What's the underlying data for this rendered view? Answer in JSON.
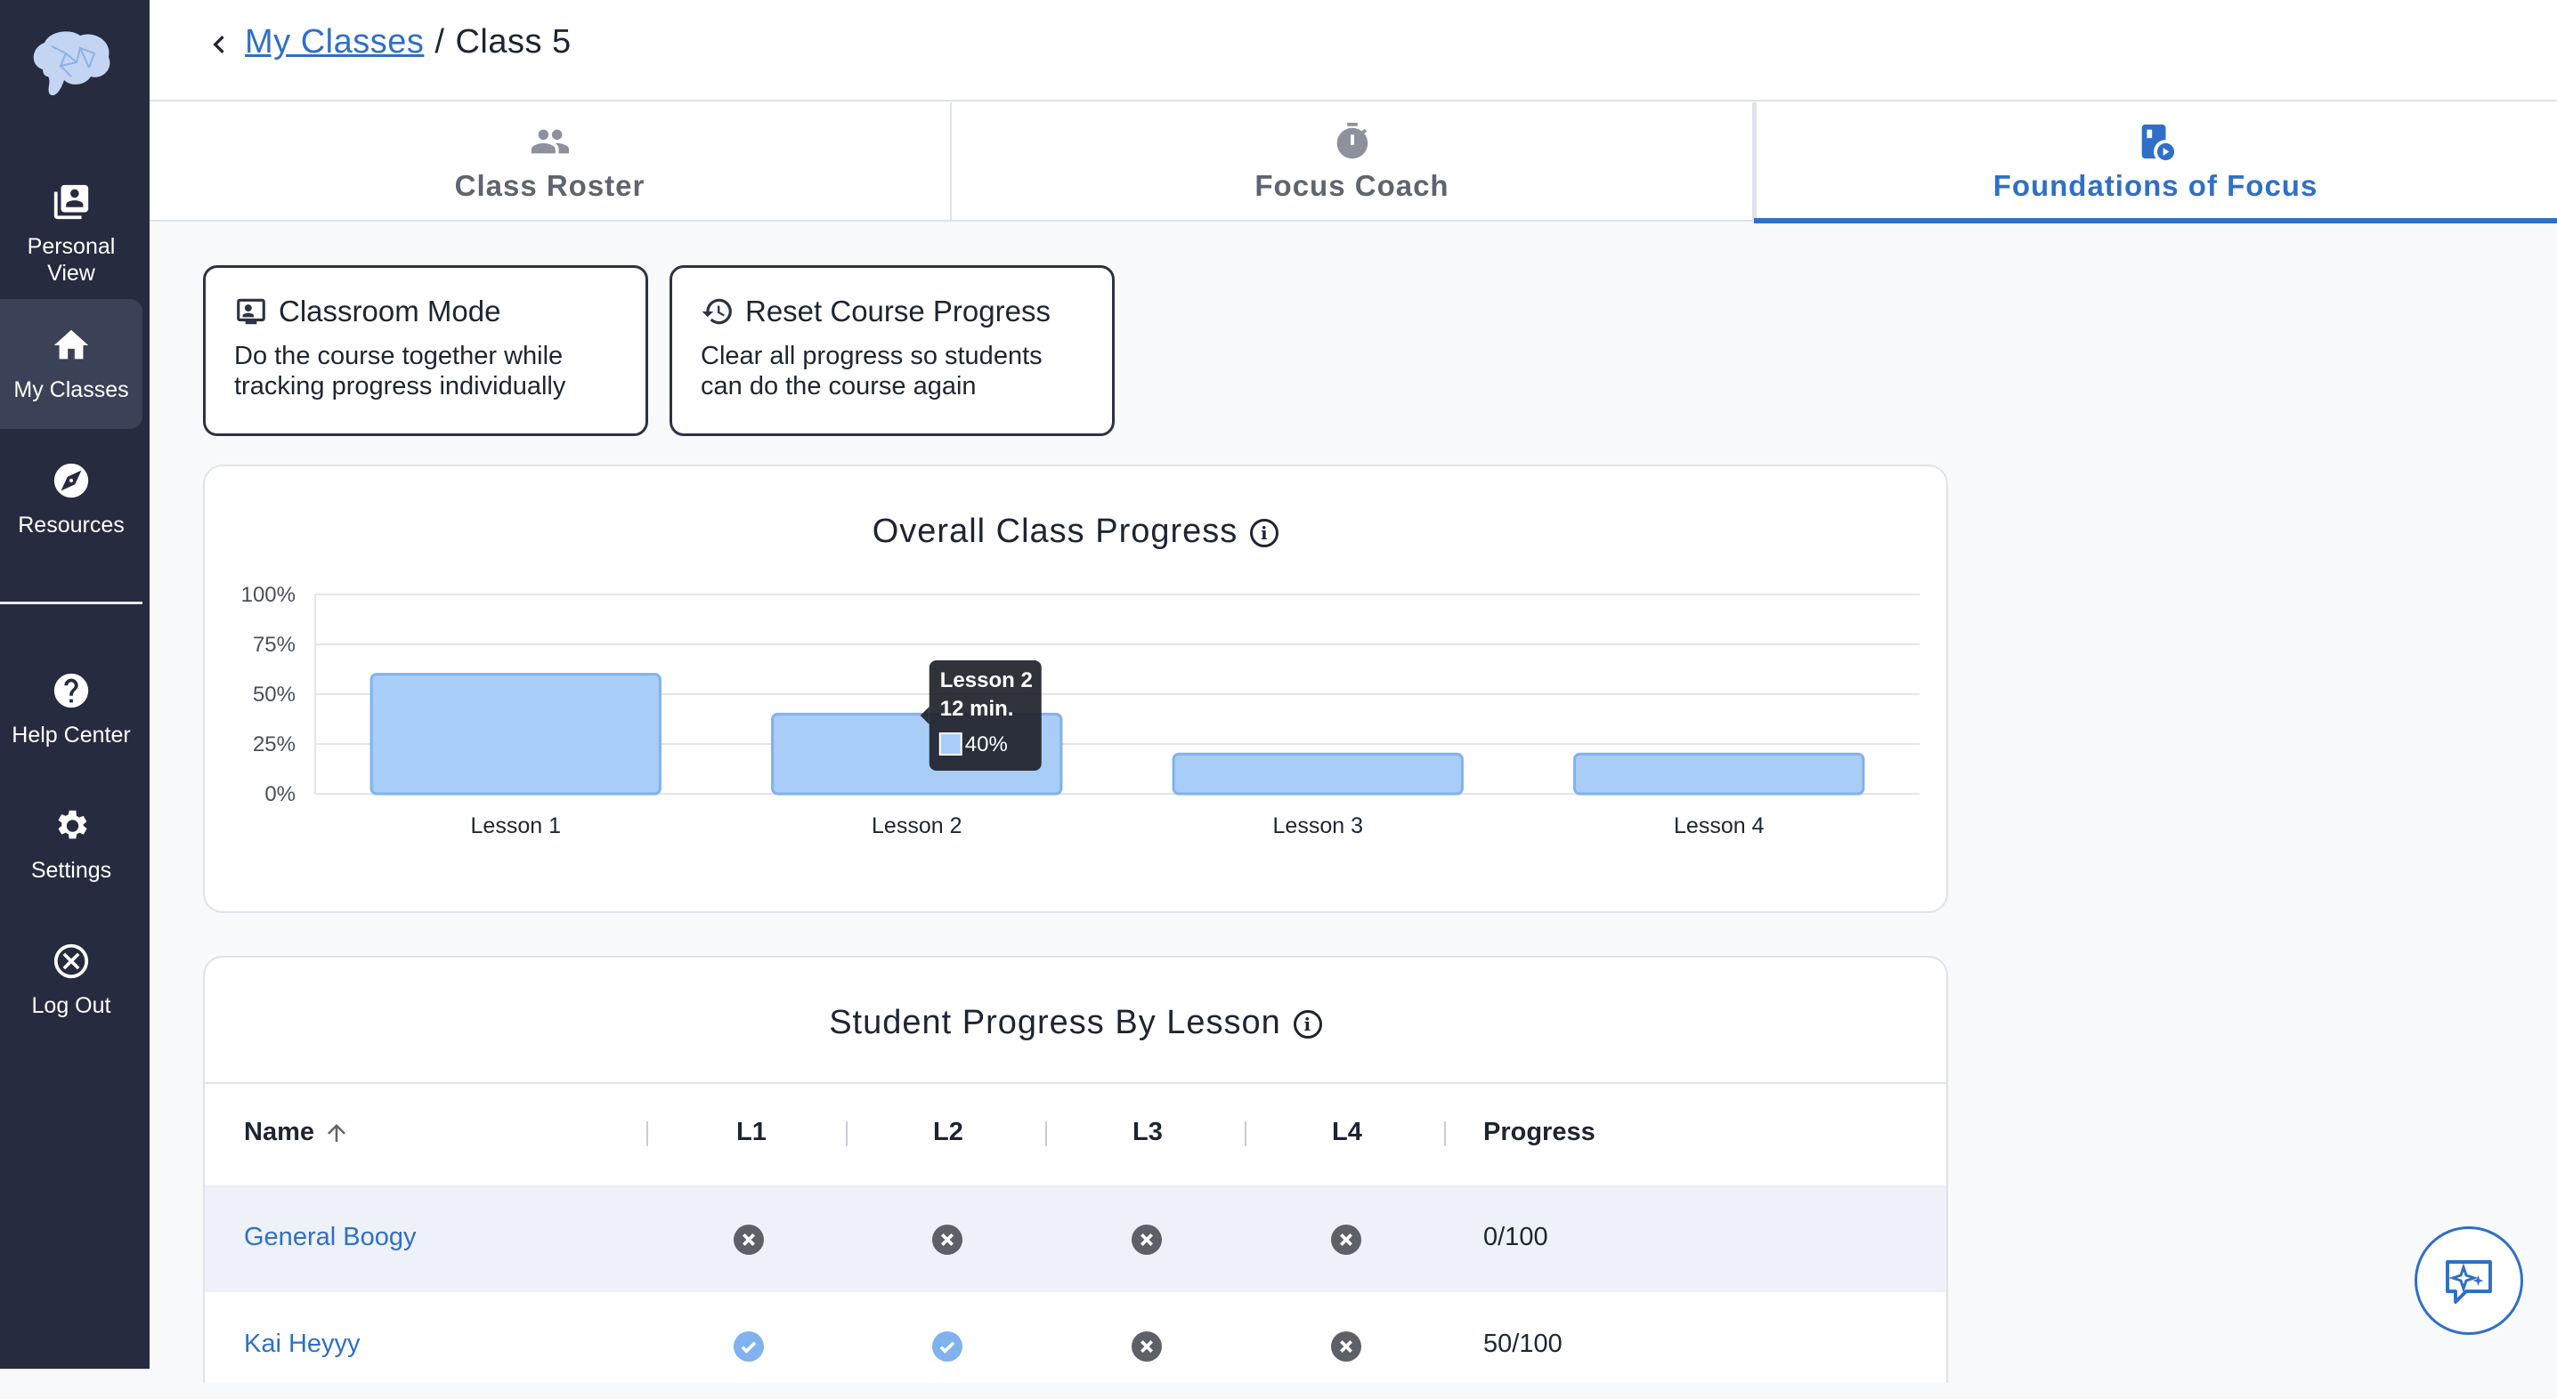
{
  "sidebar": {
    "items": [
      {
        "label": "Personal\nView",
        "icon": "personal-view-icon"
      },
      {
        "label": "My Classes",
        "icon": "home-icon"
      },
      {
        "label": "Resources",
        "icon": "compass-icon"
      },
      {
        "label": "Help Center",
        "icon": "help-icon"
      },
      {
        "label": "Settings",
        "icon": "gear-icon"
      },
      {
        "label": "Log Out",
        "icon": "close-circle-icon"
      }
    ]
  },
  "breadcrumb": {
    "parent": "My Classes",
    "separator": "/",
    "current": "Class 5"
  },
  "tabs": [
    {
      "label": "Class Roster",
      "icon": "people-icon"
    },
    {
      "label": "Focus Coach",
      "icon": "stopwatch-icon"
    },
    {
      "label": "Foundations of Focus",
      "icon": "course-play-icon",
      "active": true
    }
  ],
  "actions": {
    "classroom": {
      "title": "Classroom Mode",
      "desc_line1": "Do the course together while",
      "desc_line2": "tracking progress individually"
    },
    "reset": {
      "title": "Reset Course Progress",
      "desc_line1": "Clear all progress so students",
      "desc_line2": "can do the course again"
    }
  },
  "chart_data": {
    "type": "bar",
    "title": "Overall Class Progress",
    "categories": [
      "Lesson 1",
      "Lesson 2",
      "Lesson 3",
      "Lesson 4"
    ],
    "values": [
      60,
      40,
      20,
      20
    ],
    "y_ticks": [
      "0%",
      "25%",
      "50%",
      "75%",
      "100%"
    ],
    "ylim": [
      0,
      100
    ],
    "grid": true,
    "bar_color": "#a8cdf7",
    "bar_border": "#7fb2ee",
    "tooltip": {
      "title": "Lesson 2",
      "duration": "12 min.",
      "value": "40%"
    }
  },
  "table": {
    "title": "Student Progress By Lesson",
    "headers": {
      "name": "Name",
      "l1": "L1",
      "l2": "L2",
      "l3": "L3",
      "l4": "L4",
      "progress": "Progress"
    },
    "rows": [
      {
        "name": "General Boogy",
        "lessons": [
          "x",
          "x",
          "x",
          "x"
        ],
        "progress": "0/100"
      },
      {
        "name": "Kai Heyyy",
        "lessons": [
          "ok",
          "ok",
          "x",
          "x"
        ],
        "progress": "50/100"
      }
    ]
  },
  "colors": {
    "accent": "#2f6fc8",
    "sidebar": "#262b3f"
  }
}
